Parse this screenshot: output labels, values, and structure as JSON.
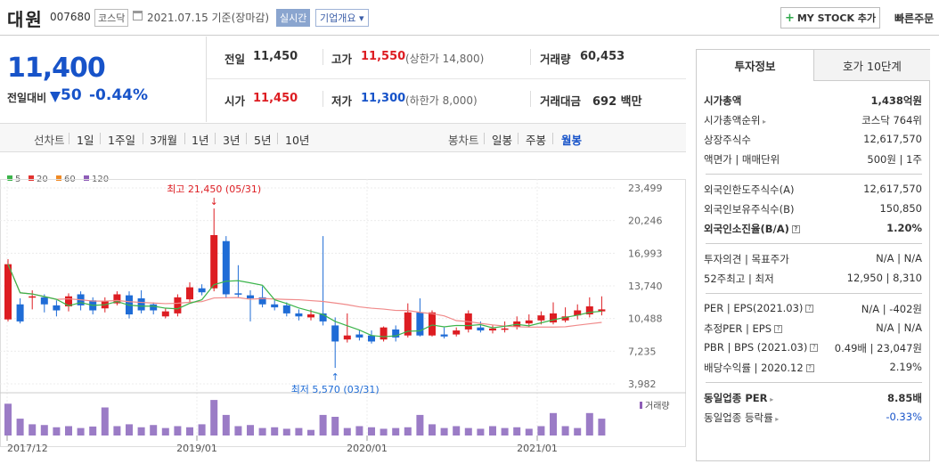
{
  "header": {
    "name": "대원",
    "code": "007680",
    "market": "코스닥",
    "date": "2021.07.15 기준(장마감)",
    "live": "실시간",
    "overview": "기업개요",
    "mystock_label": "MY STOCK 추가",
    "quickorder": "빠른주문"
  },
  "price": {
    "current": "11,400",
    "prev_label": "전일대비",
    "change": "50",
    "change_pct": "-0.44%"
  },
  "stats": {
    "prev_close_label": "전일",
    "prev_close": "11,450",
    "high_label": "고가",
    "high": "11,550",
    "upper_limit": "(상한가 14,800)",
    "volume_label": "거래량",
    "volume": "60,453",
    "open_label": "시가",
    "open": "11,450",
    "low_label": "저가",
    "low": "11,300",
    "lower_limit": "(하한가 8,000)",
    "amount_label": "거래대금",
    "amount": "692 백만"
  },
  "period_bar": {
    "line_label": "선차트",
    "periods": [
      "1일",
      "1주일",
      "3개월",
      "1년",
      "3년",
      "5년",
      "10년"
    ],
    "candle_label": "봉차트",
    "candles": [
      "일봉",
      "주봉",
      "월봉"
    ],
    "active_candle": "월봉"
  },
  "legend": [
    {
      "label": "5",
      "color": "#3bb44a"
    },
    {
      "label": "20",
      "color": "#e2322f"
    },
    {
      "label": "60",
      "color": "#f08a24"
    },
    {
      "label": "120",
      "color": "#8e5db7"
    }
  ],
  "chart_data": {
    "type": "candlestick",
    "y_ticks": [
      "23,499",
      "20,246",
      "16,993",
      "13,740",
      "10,488",
      "7,235",
      "3,982"
    ],
    "ylim": [
      3982,
      23499
    ],
    "x_ticks": [
      "2017/12",
      "2019/01",
      "2020/01",
      "2021/01"
    ],
    "high_annotation": "최고 21,450 (05/31)",
    "low_annotation": "최저 5,570 (03/31)",
    "volume_label": "거래량",
    "candles": [
      {
        "o": 10400,
        "c": 15900,
        "h": 16400,
        "l": 10200
      },
      {
        "o": 11900,
        "c": 10200,
        "h": 12500,
        "l": 10000
      },
      {
        "o": 12600,
        "c": 12700,
        "h": 13300,
        "l": 11400
      },
      {
        "o": 12600,
        "c": 11900,
        "h": 12900,
        "l": 11100
      },
      {
        "o": 11800,
        "c": 11300,
        "h": 12300,
        "l": 10700
      },
      {
        "o": 11700,
        "c": 12700,
        "h": 13000,
        "l": 11200
      },
      {
        "o": 12900,
        "c": 11800,
        "h": 13200,
        "l": 11300
      },
      {
        "o": 12300,
        "c": 11300,
        "h": 12600,
        "l": 10900
      },
      {
        "o": 11500,
        "c": 12200,
        "h": 12600,
        "l": 11100
      },
      {
        "o": 12000,
        "c": 12900,
        "h": 13200,
        "l": 11800
      },
      {
        "o": 12800,
        "c": 10900,
        "h": 13200,
        "l": 10500
      },
      {
        "o": 12500,
        "c": 11300,
        "h": 13300,
        "l": 11000
      },
      {
        "o": 11900,
        "c": 11300,
        "h": 12100,
        "l": 10900
      },
      {
        "o": 10700,
        "c": 11200,
        "h": 11500,
        "l": 10500
      },
      {
        "o": 11000,
        "c": 12600,
        "h": 12900,
        "l": 10700
      },
      {
        "o": 12400,
        "c": 13600,
        "h": 14100,
        "l": 12000
      },
      {
        "o": 13500,
        "c": 13100,
        "h": 13900,
        "l": 12800
      },
      {
        "o": 13500,
        "c": 18800,
        "h": 21450,
        "l": 13200
      },
      {
        "o": 18200,
        "c": 12900,
        "h": 18700,
        "l": 12500
      },
      {
        "o": 13000,
        "c": 12900,
        "h": 15800,
        "l": 12600
      },
      {
        "o": 12800,
        "c": 12500,
        "h": 13300,
        "l": 10200
      },
      {
        "o": 12600,
        "c": 11900,
        "h": 13700,
        "l": 11600
      },
      {
        "o": 11900,
        "c": 11600,
        "h": 12300,
        "l": 11300
      },
      {
        "o": 11800,
        "c": 11000,
        "h": 12100,
        "l": 10700
      },
      {
        "o": 11000,
        "c": 10700,
        "h": 11400,
        "l": 10300
      },
      {
        "o": 10600,
        "c": 10900,
        "h": 11400,
        "l": 10300
      },
      {
        "o": 11000,
        "c": 10200,
        "h": 18700,
        "l": 9800
      },
      {
        "o": 9800,
        "c": 8200,
        "h": 10600,
        "l": 5570
      },
      {
        "o": 8400,
        "c": 8800,
        "h": 11000,
        "l": 8100
      },
      {
        "o": 8900,
        "c": 8600,
        "h": 9300,
        "l": 8300
      },
      {
        "o": 8800,
        "c": 8200,
        "h": 9300,
        "l": 8000
      },
      {
        "o": 8400,
        "c": 9600,
        "h": 9700,
        "l": 8200
      },
      {
        "o": 9400,
        "c": 8600,
        "h": 9800,
        "l": 8200
      },
      {
        "o": 8800,
        "c": 11100,
        "h": 12000,
        "l": 8600
      },
      {
        "o": 11100,
        "c": 8800,
        "h": 12500,
        "l": 8700
      },
      {
        "o": 8800,
        "c": 11100,
        "h": 11300,
        "l": 8700
      },
      {
        "o": 8900,
        "c": 8700,
        "h": 9600,
        "l": 8500
      },
      {
        "o": 8900,
        "c": 9300,
        "h": 9600,
        "l": 8700
      },
      {
        "o": 9400,
        "c": 11000,
        "h": 11300,
        "l": 9100
      },
      {
        "o": 9600,
        "c": 9300,
        "h": 10200,
        "l": 9100
      },
      {
        "o": 9300,
        "c": 9500,
        "h": 9800,
        "l": 9000
      },
      {
        "o": 9500,
        "c": 9500,
        "h": 10200,
        "l": 9100
      },
      {
        "o": 9700,
        "c": 10200,
        "h": 10700,
        "l": 9400
      },
      {
        "o": 10000,
        "c": 10300,
        "h": 10900,
        "l": 9600
      },
      {
        "o": 10300,
        "c": 10800,
        "h": 11200,
        "l": 9900
      },
      {
        "o": 10100,
        "c": 11000,
        "h": 12100,
        "l": 9900
      },
      {
        "o": 10300,
        "c": 10700,
        "h": 11600,
        "l": 10100
      },
      {
        "o": 10800,
        "c": 11300,
        "h": 11900,
        "l": 10400
      },
      {
        "o": 10900,
        "c": 11700,
        "h": 12600,
        "l": 10600
      },
      {
        "o": 11200,
        "c": 11400,
        "h": 12700,
        "l": 10800
      }
    ],
    "volumes": [
      0.85,
      0.45,
      0.3,
      0.28,
      0.22,
      0.25,
      0.2,
      0.24,
      0.75,
      0.25,
      0.3,
      0.22,
      0.28,
      0.2,
      0.25,
      0.22,
      0.3,
      0.95,
      0.55,
      0.25,
      0.28,
      0.2,
      0.22,
      0.18,
      0.2,
      0.15,
      0.55,
      0.5,
      0.2,
      0.25,
      0.22,
      0.18,
      0.2,
      0.22,
      0.55,
      0.3,
      0.2,
      0.25,
      0.2,
      0.18,
      0.25,
      0.2,
      0.22,
      0.18,
      0.25,
      0.6,
      0.25,
      0.2,
      0.6,
      0.45
    ]
  },
  "right_panel": {
    "tab_active": "투자정보",
    "tab_inactive": "호가 10단계",
    "rows1": [
      {
        "label": "시가총액",
        "value": "1,438억원",
        "bold": true
      },
      {
        "label": "시가총액순위",
        "value": "코스닥 764위",
        "arrow": true
      },
      {
        "label": "상장주식수",
        "value": "12,617,570"
      },
      {
        "label": "액면가 | 매매단위",
        "value": "500원 | 1주"
      }
    ],
    "rows2": [
      {
        "label": "외국인한도주식수(A)",
        "value": "12,617,570"
      },
      {
        "label": "외국인보유주식수(B)",
        "value": "150,850"
      },
      {
        "label": "외국인소진율(B/A)",
        "value": "1.20%",
        "bold": true,
        "pip": true
      }
    ],
    "rows3": [
      {
        "label": "투자의견 | 목표주가",
        "value": "N/A | N/A"
      },
      {
        "label": "52주최고 | 최저",
        "value": "12,950 | 8,310"
      }
    ],
    "rows4": [
      {
        "label": "PER | EPS(2021.03)",
        "value": "N/A | -402원",
        "pip": true
      },
      {
        "label": "추정PER | EPS",
        "value": "N/A | N/A",
        "pip": true
      },
      {
        "label": "PBR | BPS (2021.03)",
        "value": "0.49배 | 23,047원",
        "pip": true
      },
      {
        "label": "배당수익률 | 2020.12",
        "value": "2.19%",
        "pip": true
      }
    ],
    "rows5": [
      {
        "label": "동일업종 PER",
        "value": "8.85배",
        "bold": true,
        "arrow": true
      },
      {
        "label": "동일업종 등락률",
        "value": "-0.33%",
        "blue": true,
        "arrow": true
      }
    ]
  }
}
